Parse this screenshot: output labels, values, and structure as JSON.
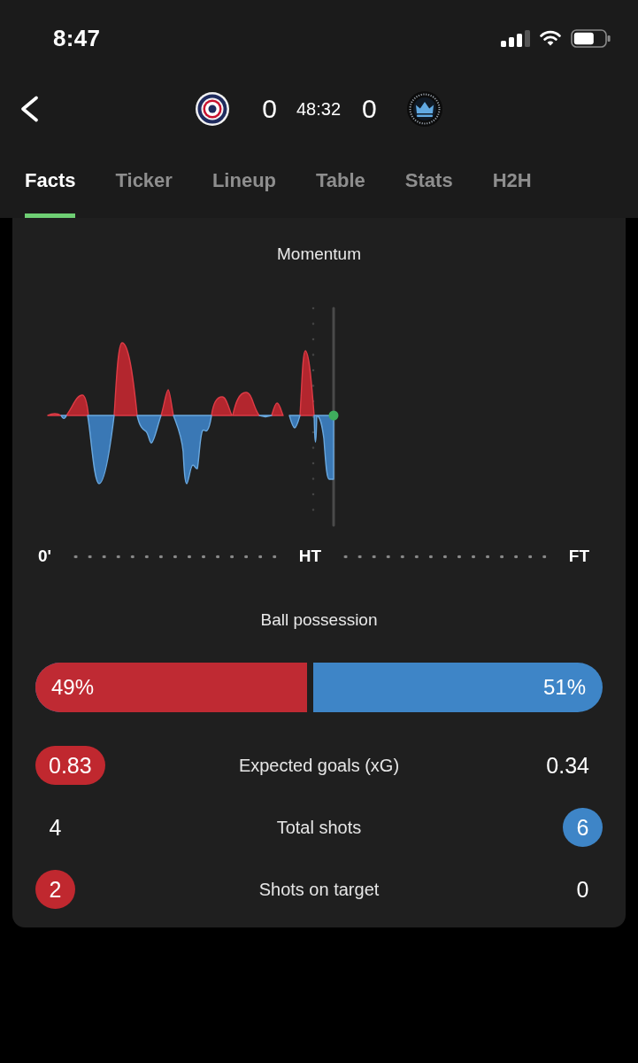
{
  "status_bar": {
    "time": "8:47"
  },
  "match": {
    "home_score": "0",
    "clock": "48:32",
    "away_score": "0"
  },
  "tabs": [
    {
      "label": "Facts",
      "selected": true
    },
    {
      "label": "Ticker",
      "selected": false
    },
    {
      "label": "Lineup",
      "selected": false
    },
    {
      "label": "Table",
      "selected": false
    },
    {
      "label": "Stats",
      "selected": false
    },
    {
      "label": "H2H",
      "selected": false
    }
  ],
  "momentum": {
    "title": "Momentum",
    "timeline_labels": [
      "0'",
      "HT",
      "FT"
    ]
  },
  "possession": {
    "title": "Ball possession",
    "level": 0.49,
    "home_label": "49%",
    "away_label": "51%"
  },
  "stats": [
    {
      "label": "Expected goals (xG)",
      "home": {
        "value": "0.83",
        "highlighted": true
      },
      "away": {
        "value": "0.34",
        "highlighted": false
      }
    },
    {
      "label": "Total shots",
      "home": {
        "value": "4",
        "highlighted": false
      },
      "away": {
        "value": "6",
        "highlighted": true
      }
    },
    {
      "label": "Shots on target",
      "home": {
        "value": "2",
        "highlighted": true
      },
      "away": {
        "value": "0",
        "highlighted": false
      }
    }
  ]
}
